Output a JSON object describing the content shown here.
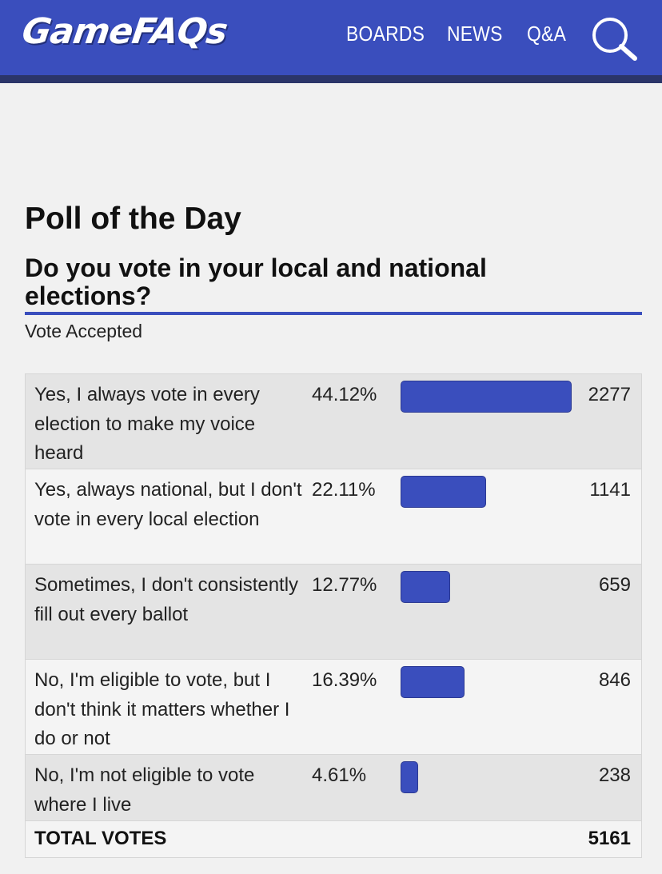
{
  "header": {
    "logo": "GameFAQs",
    "nav": [
      "BOARDS",
      "NEWS",
      "Q&A"
    ],
    "search_icon": "search-icon",
    "colors": {
      "bar": "#3a4ebd",
      "strip": "#2b3569"
    }
  },
  "poll": {
    "page_title": "Poll of the Day",
    "question": "Do you vote in your local and national elections?",
    "status": "Vote Accepted",
    "options": [
      {
        "label": "Yes, I always vote in every election to make my voice heard",
        "percent": "44.12%",
        "votes": "2277",
        "fraction": 1.0
      },
      {
        "label": "Yes, always national, but I don't vote in every local election",
        "percent": "22.11%",
        "votes": "1141",
        "fraction": 0.501
      },
      {
        "label": "Sometimes, I don't consistently fill out every ballot",
        "percent": "12.77%",
        "votes": "659",
        "fraction": 0.289
      },
      {
        "label": "No, I'm eligible to vote, but I don't think it matters whether I do or not",
        "percent": "16.39%",
        "votes": "846",
        "fraction": 0.372
      },
      {
        "label": "No, I'm not eligible to vote where I live",
        "percent": "4.61%",
        "votes": "238",
        "fraction": 0.105
      }
    ],
    "total_label": "TOTAL VOTES",
    "total_votes": "5161",
    "bar_color": "#3a4ebd"
  }
}
